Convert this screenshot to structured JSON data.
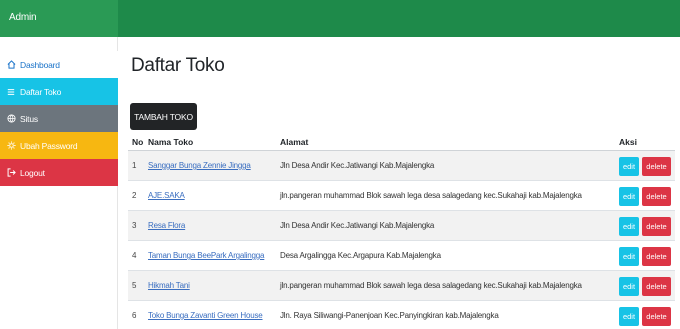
{
  "header": {
    "brand": "Admin",
    "brand_color": "#1e8a4a"
  },
  "sidebar": {
    "items": [
      {
        "label": "Dashboard",
        "icon": "home-icon",
        "color": "#ffffff"
      },
      {
        "label": "Daftar Toko",
        "icon": "list-icon",
        "color": "#17c3e6"
      },
      {
        "label": "Situs",
        "icon": "globe-icon",
        "color": "#6c757d"
      },
      {
        "label": "Ubah Password",
        "icon": "gear-icon",
        "color": "#f7b711"
      },
      {
        "label": "Logout",
        "icon": "logout-icon",
        "color": "#dc3545"
      }
    ]
  },
  "main": {
    "title": "Daftar Toko",
    "add_button": "TAMBAH TOKO",
    "table": {
      "columns": [
        "No",
        "Nama Toko",
        "Alamat",
        "Aksi"
      ],
      "edit_label": "edit",
      "delete_label": "delete",
      "rows": [
        {
          "no": "1",
          "name": "Sanggar Bunga Zennie Jingga",
          "address": "Jln Desa Andir Kec.Jatiwangi Kab.Majalengka"
        },
        {
          "no": "2",
          "name": "AJE.SAKA",
          "address": "jln.pangeran muhammad Blok sawah lega desa salagedang kec.Sukahaji kab.Majalengka"
        },
        {
          "no": "3",
          "name": "Resa Flora",
          "address": "Jln Desa Andir Kec.Jatiwangi Kab.Majalengka"
        },
        {
          "no": "4",
          "name": "Taman Bunga BeePark Argalingga",
          "address": "Desa Argalingga Kec.Argapura Kab.Majalengka"
        },
        {
          "no": "5",
          "name": "Hikmah Tani",
          "address": "jln.pangeran muhammad Blok sawah lega desa salagedang kec.Sukahaji kab.Majalengka"
        },
        {
          "no": "6",
          "name": "Toko Bunga Zavanti Green House",
          "address": "Jln. Raya Siliwangi-Panenjoan Kec.Panyingkiran kab.Majalengka"
        }
      ]
    }
  }
}
